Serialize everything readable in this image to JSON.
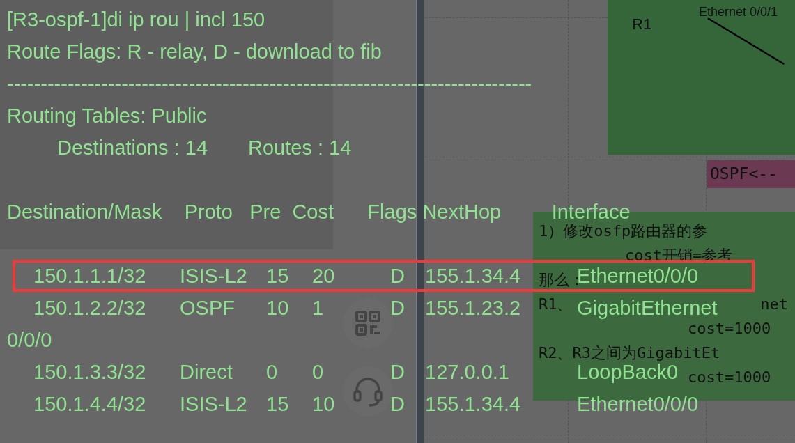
{
  "terminal": {
    "command": "[R3-ospf-1]di ip rou | incl 150",
    "legend": "Route Flags: R - relay, D - download to fib",
    "separator": "------------------------------------------------------------------------------",
    "table_title": "Routing Tables: Public",
    "summary": [
      "Destinations : 14",
      "Routes : 14"
    ],
    "header": "Destination/Mask    Proto   Pre  Cost      Flags NextHop         Interface",
    "routes": [
      {
        "destination": "150.1.1.1/32",
        "proto": "ISIS-L2",
        "pre": "15",
        "cost": "20",
        "flags": "D",
        "nexthop": "155.1.34.4",
        "interface": "Ethernet0/0/0",
        "highlighted": true
      },
      {
        "destination": "150.1.2.2/32",
        "proto": "OSPF",
        "pre": "10",
        "cost": "1",
        "flags": "D",
        "nexthop": "155.1.23.2",
        "interface": "GigabitEthernet",
        "interface_continued": "0/0/0",
        "highlighted": false
      },
      {
        "destination": "150.1.3.3/32",
        "proto": "Direct",
        "pre": "0",
        "cost": "0",
        "flags": "D",
        "nexthop": "127.0.0.1",
        "interface": "LoopBack0",
        "highlighted": false
      },
      {
        "destination": "150.1.4.4/32",
        "proto": "ISIS-L2",
        "pre": "15",
        "cost": "10",
        "flags": "D",
        "nexthop": "155.1.34.4",
        "interface": "Ethernet0/0/0",
        "highlighted": false
      }
    ]
  },
  "topology": {
    "router_label": "R1",
    "link_label": "Ethernet 0/0/1",
    "tag": "OSPF<--"
  },
  "note": {
    "lines": [
      {
        "text": "1）修改osfp路由器的参",
        "kind": "plain"
      },
      {
        "text": "cost开销=参考",
        "kind": "indented"
      },
      {
        "text": "那么：",
        "kind": "plain"
      },
      {
        "text": "R1、",
        "tail": "net",
        "kind": "plain"
      },
      {
        "text": "cost=1000",
        "kind": "deep"
      },
      {
        "text": "R2、R3之间为GigabitEt",
        "kind": "plain"
      },
      {
        "text": "cost=1000",
        "kind": "deep"
      }
    ]
  }
}
